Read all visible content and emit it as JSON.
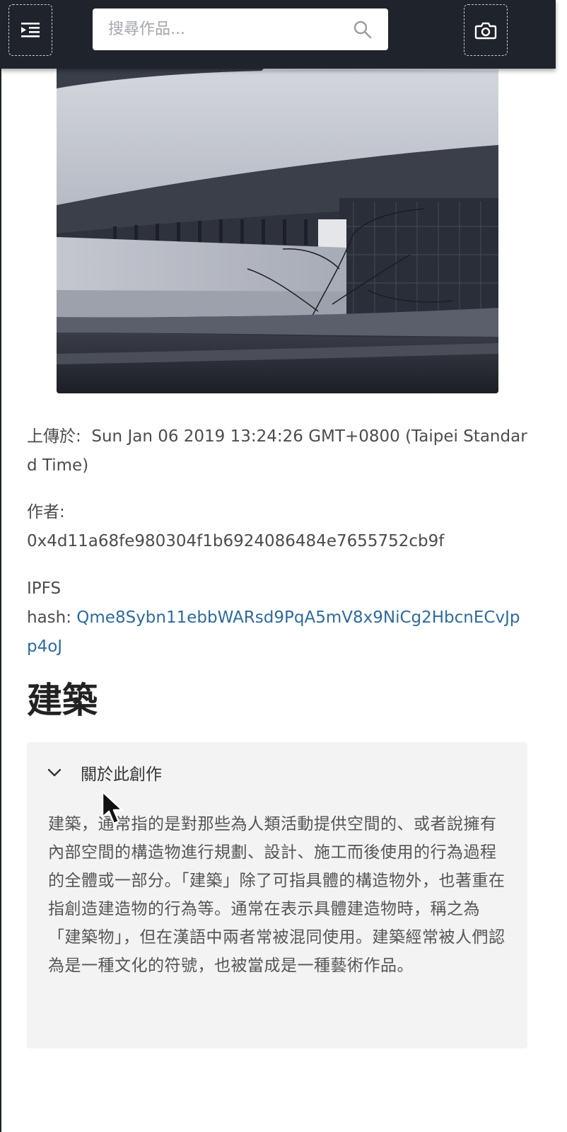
{
  "search": {
    "placeholder": "搜尋作品..."
  },
  "icons": {
    "menu": "menu-indent-icon",
    "search": "search-icon",
    "camera": "camera-icon",
    "chevron": "chevron-down-icon",
    "cursor": "mouse-pointer-icon"
  },
  "artwork": {
    "upload_label": "上傳於:",
    "upload_value": "Sun Jan 06 2019 13:24:26 GMT+0800 (Taipei Standard Time)",
    "author_label": "作者:",
    "author_value": "0x4d11a68fe980304f1b6924086484e7655752cb9f",
    "ipfs_label_line1": "IPFS",
    "ipfs_label_line2": "hash:",
    "ipfs_hash": "Qme8Sybn11ebbWARsd9PqA5mV8x9NiCg2HbcnECvJpp4oJ",
    "title": "建築"
  },
  "about": {
    "heading": "關於此創作",
    "text": "建築，通常指的是對那些為人類活動提供空間的、或者說擁有內部空間的構造物進行規劃、設計、施工而後使用的行為過程的全體或一部分。「建築」除了可指具體的構造物外，也著重在指創造建造物的行為等。通常在表示具體建造物時，稱之為「建築物」，但在漢語中兩者常被混同使用。建築經常被人們認為是一種文化的符號，也被當成是一種藝術作品。"
  },
  "colors": {
    "topbar": "#1f232b",
    "link": "#2d6a9f",
    "panel": "#f3f3f3"
  }
}
